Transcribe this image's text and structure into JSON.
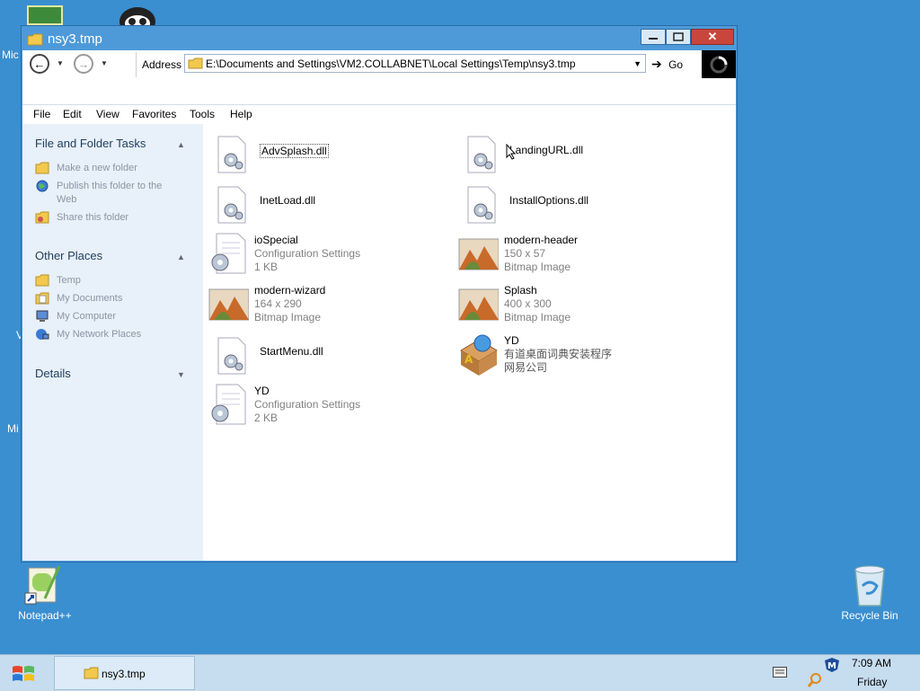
{
  "desktop": {
    "icons": [
      {
        "label": "Notepad++",
        "icon": "notepadpp-icon"
      },
      {
        "label": "Recycle Bin",
        "icon": "recycle-bin-icon"
      }
    ],
    "edge_labels": [
      "Mic",
      "Mi",
      "V"
    ]
  },
  "window": {
    "title": "nsy3.tmp",
    "address_label": "Address",
    "address_value": "E:\\Documents and Settings\\VM2.COLLABNET\\Local Settings\\Temp\\nsy3.tmp",
    "go_label": "Go",
    "menu": [
      "File",
      "Edit",
      "View",
      "Favorites",
      "Tools",
      "Help"
    ],
    "taskpane": {
      "sections": [
        {
          "title": "File and Folder Tasks",
          "items": [
            "Make a new folder",
            "Publish this folder to the Web",
            "Share this folder"
          ]
        },
        {
          "title": "Other Places",
          "items": [
            "Temp",
            "My Documents",
            "My Computer",
            "My Network Places"
          ]
        },
        {
          "title": "Details",
          "items": []
        }
      ]
    },
    "files": [
      {
        "name": "AdvSplash.dll",
        "lines": [],
        "type": "dll"
      },
      {
        "name": "LandingURL.dll",
        "lines": [],
        "type": "dll"
      },
      {
        "name": "InetLoad.dll",
        "lines": [],
        "type": "dll"
      },
      {
        "name": "InstallOptions.dll",
        "lines": [],
        "type": "dll"
      },
      {
        "name": "ioSpecial",
        "lines": [
          "Configuration Settings",
          "1 KB"
        ],
        "type": "ini"
      },
      {
        "name": "modern-header",
        "lines": [
          "150 x 57",
          "Bitmap Image"
        ],
        "type": "bmp"
      },
      {
        "name": "modern-wizard",
        "lines": [
          "164 x 290",
          "Bitmap Image"
        ],
        "type": "bmp"
      },
      {
        "name": "Splash",
        "lines": [
          "400 x 300",
          "Bitmap Image"
        ],
        "type": "bmp"
      },
      {
        "name": "StartMenu.dll",
        "lines": [],
        "type": "dll"
      },
      {
        "name": "YD",
        "lines": [
          "有道桌面词典安装程序",
          "网易公司"
        ],
        "type": "exe"
      },
      {
        "name": "YD",
        "lines": [
          "Configuration Settings",
          "2 KB"
        ],
        "type": "ini"
      }
    ]
  },
  "taskbar": {
    "task_label": "nsy3.tmp",
    "time": "7:09 AM",
    "day": "Friday"
  },
  "colors": {
    "desktop": "#3a8fd0",
    "window_frame": "#4e9ad8",
    "taskpane": "#e8f0f9",
    "close_button": "#c9463d"
  }
}
